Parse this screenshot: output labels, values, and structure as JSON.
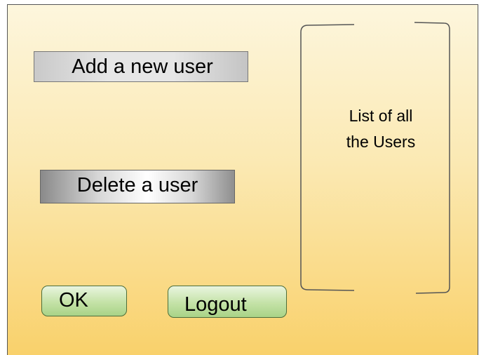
{
  "buttons": {
    "add_user": "Add a new user",
    "delete_user": "Delete a user",
    "ok": "OK",
    "logout": "Logout"
  },
  "user_list": {
    "line1": "List of all",
    "line2": "the Users"
  }
}
